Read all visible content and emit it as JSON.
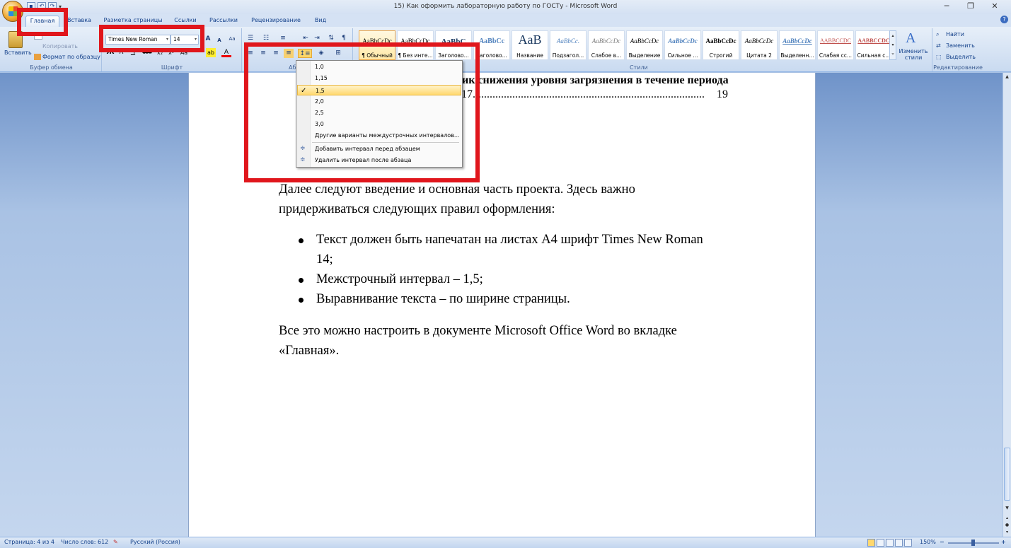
{
  "window": {
    "title": "15) Как оформить лабораторную работу по ГОСТу - Microsoft Word",
    "qat_dropdown": "▾",
    "min": "─",
    "max": "❐",
    "close": "✕"
  },
  "tabs": [
    "Главная",
    "Вставка",
    "Разметка страницы",
    "Ссылки",
    "Рассылки",
    "Рецензирование",
    "Вид"
  ],
  "ribbon": {
    "clipboard": {
      "paste": "Вставить",
      "copy": "Копировать",
      "format_painter": "Формат по образцу",
      "label": "Буфер обмена"
    },
    "font": {
      "name": "Times New Roman",
      "size": "14",
      "label": "Шрифт",
      "bold": "Ж",
      "italic": "К",
      "underline": "Ч",
      "grow": "A",
      "shrink": "A",
      "clear": "Aa",
      "strike": "abe",
      "sub": "x₂",
      "sup": "x²",
      "case": "Aa",
      "highlight": "ab",
      "color": "A"
    },
    "paragraph": {
      "label": "Абзац"
    },
    "styles": {
      "label": "Стили",
      "items": [
        {
          "sample": "AaBbCcDc",
          "name": "¶ Обычный"
        },
        {
          "sample": "AaBbCcDc",
          "name": "¶ Без инте..."
        },
        {
          "sample": "AaBbC",
          "name": "Заголово..."
        },
        {
          "sample": "AaBbCc",
          "name": "Заголово..."
        },
        {
          "sample": "AaB",
          "name": "Название"
        },
        {
          "sample": "AaBbCc.",
          "name": "Подзагол..."
        },
        {
          "sample": "AaBbCcDc",
          "name": "Слабое в..."
        },
        {
          "sample": "AaBbCcDc",
          "name": "Выделение"
        },
        {
          "sample": "AaBbCcDc",
          "name": "Сильное ..."
        },
        {
          "sample": "AaBbCcDc",
          "name": "Строгий"
        },
        {
          "sample": "AaBbCcDc",
          "name": "Цитата 2"
        },
        {
          "sample": "AaBbCcDc",
          "name": "Выделенн..."
        },
        {
          "sample": "AABBCCDC",
          "name": "Слабая сс..."
        },
        {
          "sample": "AABBCCDC",
          "name": "Сильная с..."
        }
      ],
      "change_styles": "Изменить стили"
    },
    "editing": {
      "find": "Найти",
      "replace": "Заменить",
      "select": "Выделить",
      "label": "Редактирование"
    }
  },
  "document": {
    "toc_line1": "ик снижения уровня загрязнения в течение периода",
    "toc_line2_prefix": "17",
    "toc_line2_dots": "..................................................................................",
    "toc_page": "19",
    "para1_line1": "Далее следуют введение и основная часть проекта. Здесь важно",
    "para1_line2": "придерживаться следующих правил оформления:",
    "bullets": [
      "Текст должен быть напечатан на листах А4 шрифт Times New Roman",
      "14;",
      "Межстрочный интервал – 1,5;",
      "Выравнивание текста – по ширине страницы."
    ],
    "para2_line1": "Все это можно настроить в документе Microsoft Office Word во вкладке",
    "para2_line2": "«Главная»."
  },
  "line_spacing_menu": {
    "options": [
      "1,0",
      "1,15",
      "1,5",
      "2,0",
      "2,5",
      "3,0"
    ],
    "selected": "1,5",
    "checkmark": "✓",
    "more": "Другие варианты междустрочных интервалов...",
    "add_before": "Добавить интервал перед абзацем",
    "remove_after": "Удалить интервал после абзаца"
  },
  "statusbar": {
    "page": "Страница: 4 из 4",
    "words": "Число слов: 612",
    "language": "Русский (Россия)",
    "zoom": "150%",
    "zoom_minus": "−",
    "zoom_plus": "+"
  },
  "colors": {
    "highlight_red": "#e0161c",
    "ribbon_bg": "#c9daf0",
    "selected_item": "#ffd86e"
  }
}
